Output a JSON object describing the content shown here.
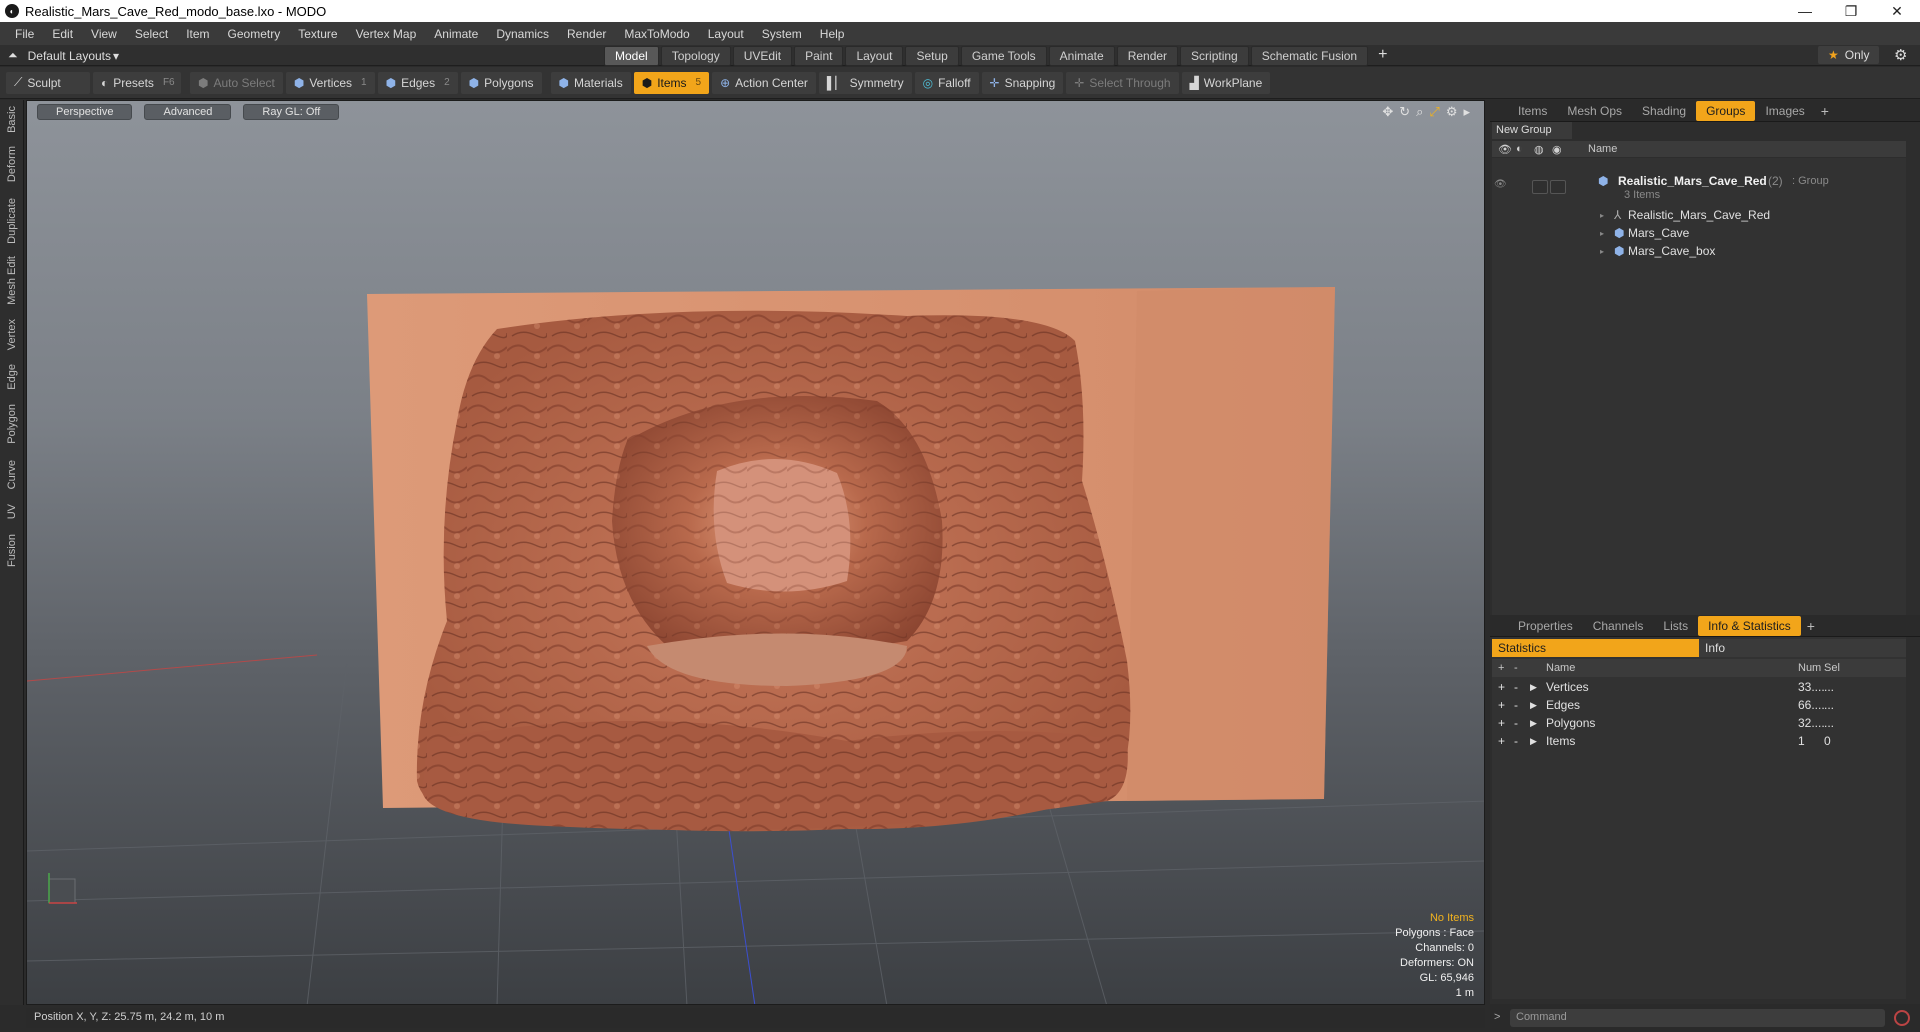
{
  "window": {
    "title": "Realistic_Mars_Cave_Red_modo_base.lxo - MODO",
    "minimize": "—",
    "maximize": "❐",
    "close": "✕"
  },
  "menu": [
    "File",
    "Edit",
    "View",
    "Select",
    "Item",
    "Geometry",
    "Texture",
    "Vertex Map",
    "Animate",
    "Dynamics",
    "Render",
    "MaxToModo",
    "Layout",
    "System",
    "Help"
  ],
  "layoutbar": {
    "layout_name": "Default Layouts",
    "tabs": [
      "Model",
      "Topology",
      "UVEdit",
      "Paint",
      "Layout",
      "Setup",
      "Game Tools",
      "Animate",
      "Render",
      "Scripting",
      "Schematic Fusion"
    ],
    "active_tab": "Model",
    "add": "+",
    "only_label": "Only"
  },
  "toolbar": {
    "sculpt": "Sculpt",
    "presets": "Presets",
    "presets_key": "F6",
    "auto_select": "Auto Select",
    "vertices": "Vertices",
    "vertices_key": "1",
    "edges": "Edges",
    "edges_key": "2",
    "polygons": "Polygons",
    "materials": "Materials",
    "items": "Items",
    "items_key": "5",
    "action_center": "Action Center",
    "symmetry": "Symmetry",
    "falloff": "Falloff",
    "snapping": "Snapping",
    "select_through": "Select Through",
    "workplane": "WorkPlane"
  },
  "left_tabs": [
    "Basic",
    "Deform",
    "Duplicate",
    "Mesh Edit",
    "Vertex",
    "Edge",
    "Polygon",
    "Curve",
    "UV",
    "Fusion"
  ],
  "viewport": {
    "view": "Perspective",
    "shading": "Advanced",
    "raygl": "Ray GL: Off",
    "info": {
      "selection": "No Items",
      "polygons": "Polygons : Face",
      "channels": "Channels: 0",
      "deformers": "Deformers: ON",
      "gl": "GL: 65,946",
      "scale": "1 m"
    }
  },
  "status": {
    "position": "Position X, Y, Z:   25.75 m, 24.2 m, 10 m"
  },
  "items_panel": {
    "tabs": [
      "Items",
      "Mesh Ops",
      "Shading",
      "Groups",
      "Images"
    ],
    "active_tab": "Groups",
    "new_group": "New Group",
    "col_name": "Name",
    "group_name": "Realistic_Mars_Cave_Red",
    "group_count": "(2)",
    "group_type": ": Group",
    "group_sub": "3 Items",
    "children": [
      "Realistic_Mars_Cave_Red",
      "Mars_Cave",
      "Mars_Cave_box"
    ]
  },
  "stats_panel": {
    "tabs": [
      "Properties",
      "Channels",
      "Lists",
      "Info & Statistics"
    ],
    "active_tab": "Info & Statistics",
    "sub_tabs": [
      "Statistics",
      "Info"
    ],
    "headers": {
      "name": "Name",
      "num": "Num",
      "sel": "Sel"
    },
    "rows": [
      {
        "name": "Vertices",
        "num": "33....",
        "sel": "..."
      },
      {
        "name": "Edges",
        "num": "66....",
        "sel": "..."
      },
      {
        "name": "Polygons",
        "num": "32....",
        "sel": "..."
      },
      {
        "name": "Items",
        "num": "1",
        "sel": "0"
      }
    ]
  },
  "command": {
    "placeholder": "Command",
    "prompt": ">"
  },
  "colors": {
    "accent": "#f2a51a",
    "cave": "#c97a5c",
    "cave_dark": "#8e4a35"
  }
}
